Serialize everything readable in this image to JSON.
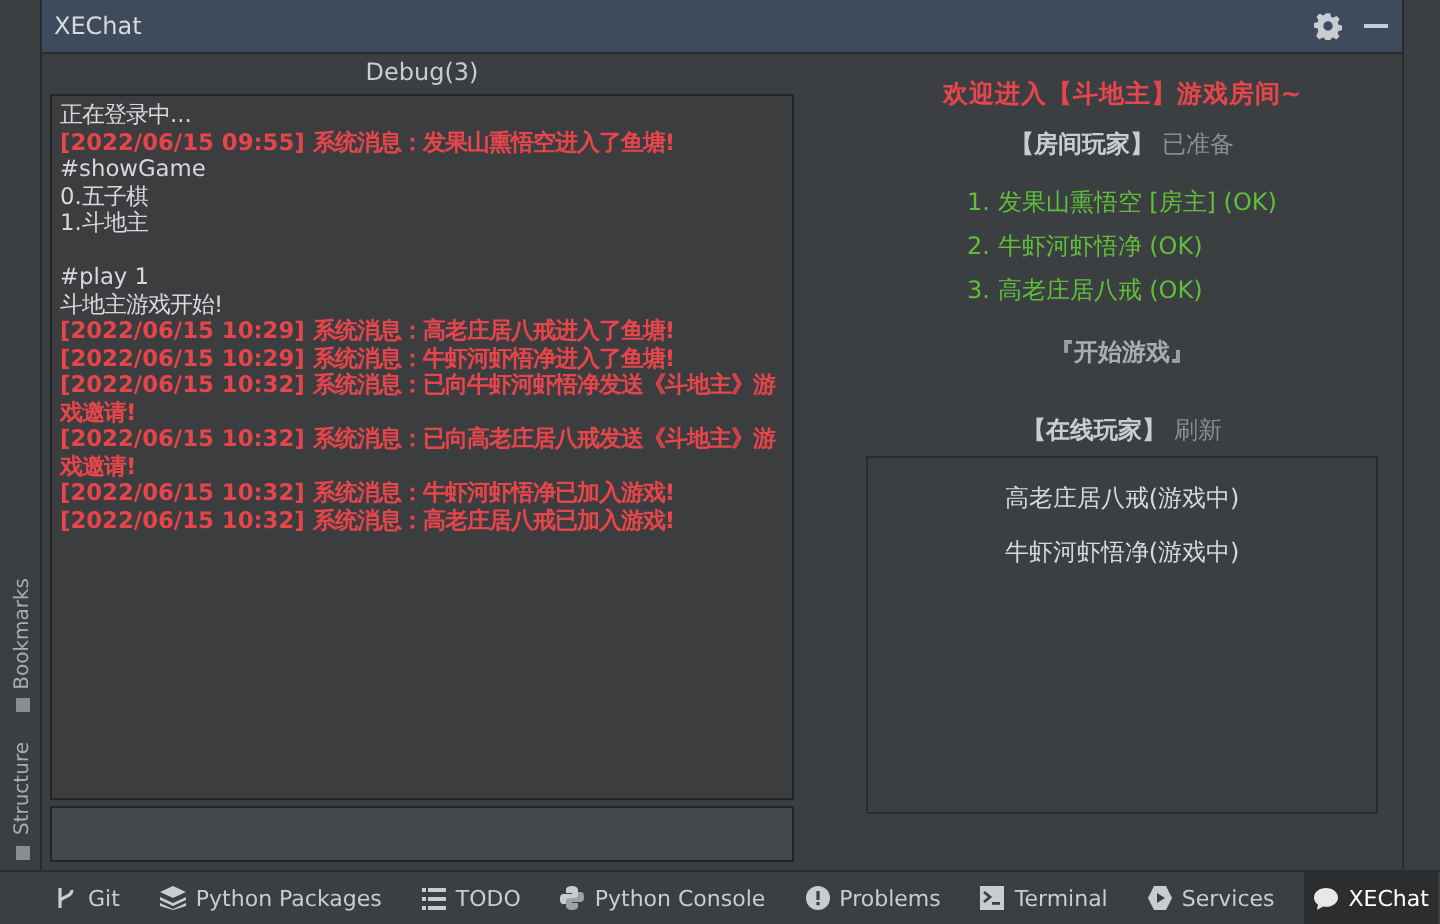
{
  "window": {
    "title": "XEChat"
  },
  "side_tabs": [
    {
      "label": "Bookmarks"
    },
    {
      "label": "Structure"
    }
  ],
  "log": {
    "title": "Debug(3)",
    "lines": [
      {
        "kind": "normal",
        "text": "正在登录中..."
      },
      {
        "kind": "system",
        "text": "[2022/06/15 09:55] 系统消息：发果山熏悟空进入了鱼塘!"
      },
      {
        "kind": "normal",
        "text": "#showGame"
      },
      {
        "kind": "normal",
        "text": "0.五子棋"
      },
      {
        "kind": "normal",
        "text": "1.斗地主"
      },
      {
        "kind": "blank"
      },
      {
        "kind": "normal",
        "text": "#play 1"
      },
      {
        "kind": "normal",
        "text": "斗地主游戏开始!"
      },
      {
        "kind": "system",
        "text": "[2022/06/15 10:29] 系统消息：高老庄居八戒进入了鱼塘!"
      },
      {
        "kind": "system",
        "text": "[2022/06/15 10:29] 系统消息：牛虾河虾悟净进入了鱼塘!"
      },
      {
        "kind": "system",
        "text": "[2022/06/15 10:32] 系统消息：已向牛虾河虾悟净发送《斗地主》游戏邀请!"
      },
      {
        "kind": "system",
        "text": "[2022/06/15 10:32] 系统消息：已向高老庄居八戒发送《斗地主》游戏邀请!"
      },
      {
        "kind": "system",
        "text": "[2022/06/15 10:32] 系统消息：牛虾河虾悟净已加入游戏!"
      },
      {
        "kind": "system",
        "text": "[2022/06/15 10:32] 系统消息：高老庄居八戒已加入游戏!"
      }
    ]
  },
  "room": {
    "welcome": "欢迎进入【斗地主】游戏房间~",
    "players_heading": "【房间玩家】",
    "players_status": "已准备",
    "players": [
      "1. 发果山熏悟空 [房主] (OK)",
      "2. 牛虾河虾悟净 (OK)",
      "3. 高老庄居八戒 (OK)"
    ],
    "start_button": "『开始游戏』",
    "online_heading": "【在线玩家】",
    "refresh_link": "刷新",
    "online": [
      "高老庄居八戒(游戏中)",
      "牛虾河虾悟净(游戏中)"
    ]
  },
  "toolbar": [
    {
      "kind": "git",
      "label": "Git",
      "selected": false
    },
    {
      "kind": "layers",
      "label": "Python Packages",
      "selected": false
    },
    {
      "kind": "list",
      "label": "TODO",
      "selected": false
    },
    {
      "kind": "python",
      "label": "Python Console",
      "selected": false
    },
    {
      "kind": "alert",
      "label": "Problems",
      "selected": false
    },
    {
      "kind": "terminal",
      "label": "Terminal",
      "selected": false
    },
    {
      "kind": "play",
      "label": "Services",
      "selected": false
    },
    {
      "kind": "chat",
      "label": "XEChat",
      "selected": true
    }
  ]
}
